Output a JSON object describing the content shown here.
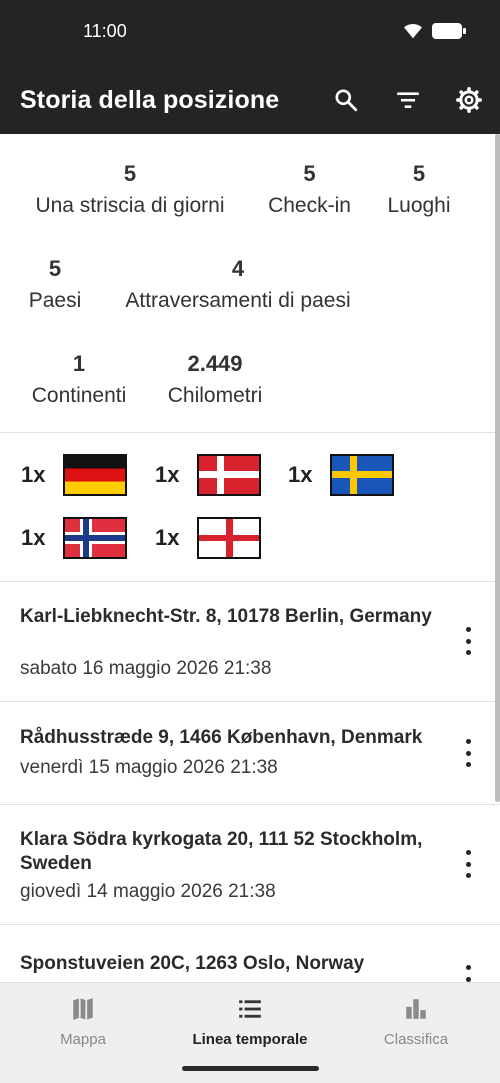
{
  "status_bar": {
    "time": "11:00"
  },
  "app_bar": {
    "title": "Storia della posizione",
    "actions": [
      "search-icon",
      "filter-icon",
      "gear-icon"
    ]
  },
  "stats": [
    {
      "value": "5",
      "label": "Una striscia di giorni"
    },
    {
      "value": "5",
      "label": "Check-in"
    },
    {
      "value": "5",
      "label": "Luoghi"
    },
    {
      "value": "5",
      "label": "Paesi"
    },
    {
      "value": "4",
      "label": "Attraversamenti di paesi"
    },
    {
      "value": "1",
      "label": "Continenti"
    },
    {
      "value": "2.449",
      "label": "Chilometri"
    }
  ],
  "flags": [
    {
      "count": "1x",
      "country": "germany-flag"
    },
    {
      "count": "1x",
      "country": "denmark-flag"
    },
    {
      "count": "1x",
      "country": "sweden-flag"
    },
    {
      "count": "1x",
      "country": "norway-flag"
    },
    {
      "count": "1x",
      "country": "england-flag"
    }
  ],
  "history": [
    {
      "address": "Karl-Liebknecht-Str. 8, 10178 Berlin, Germany",
      "date": "sabato 16 maggio 2026 21:38"
    },
    {
      "address": "Rådhusstræde 9, 1466 København, Denmark",
      "date": "venerdì 15 maggio 2026 21:38"
    },
    {
      "address": "Klara Södra kyrkogata 20, 111 52 Stockholm, Sweden",
      "date": "giovedì 14 maggio 2026 21:38"
    },
    {
      "address": "Sponstuveien 20C, 1263 Oslo, Norway",
      "date": ""
    }
  ],
  "bottom_nav": [
    {
      "label": "Mappa",
      "icon": "map-icon",
      "active": false
    },
    {
      "label": "Linea temporale",
      "icon": "list-icon",
      "active": true
    },
    {
      "label": "Classifica",
      "icon": "bar-chart-icon",
      "active": false
    }
  ],
  "colors": {
    "bar": "#242424",
    "nav_bg": "#efefef",
    "inactive": "#888888"
  }
}
